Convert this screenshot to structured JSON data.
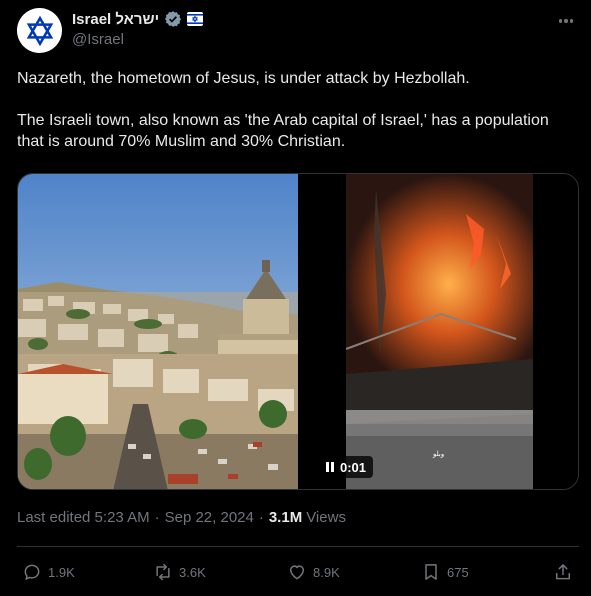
{
  "author": {
    "display_name": "Israel ישראל",
    "handle": "@Israel",
    "avatar_icon": "star-of-david-icon",
    "verified_color": "#829aab"
  },
  "more_icon": "more-icon",
  "tweet": {
    "paragraph1": "Nazareth, the hometown of Jesus, is under attack by Hezbollah.",
    "paragraph2": "The Israeli town, also known as 'the Arab capital of Israel,' has a population that is around 70% Muslim and 30% Christian."
  },
  "media": {
    "video_duration": "0:01",
    "video_caption": "وبلو"
  },
  "meta": {
    "edited_text": "Last edited 5:23 AM",
    "separator": "·",
    "date": "Sep 22, 2024",
    "views_count": "3.1M",
    "views_label": "Views"
  },
  "actions": {
    "replies": "1.9K",
    "reposts": "3.6K",
    "likes": "8.9K",
    "bookmarks": "675"
  },
  "colors": {
    "background": "#000000",
    "text": "#e7e9ea",
    "secondary": "#71767b",
    "border": "#2f3336",
    "flag_blue": "#0038b8"
  }
}
